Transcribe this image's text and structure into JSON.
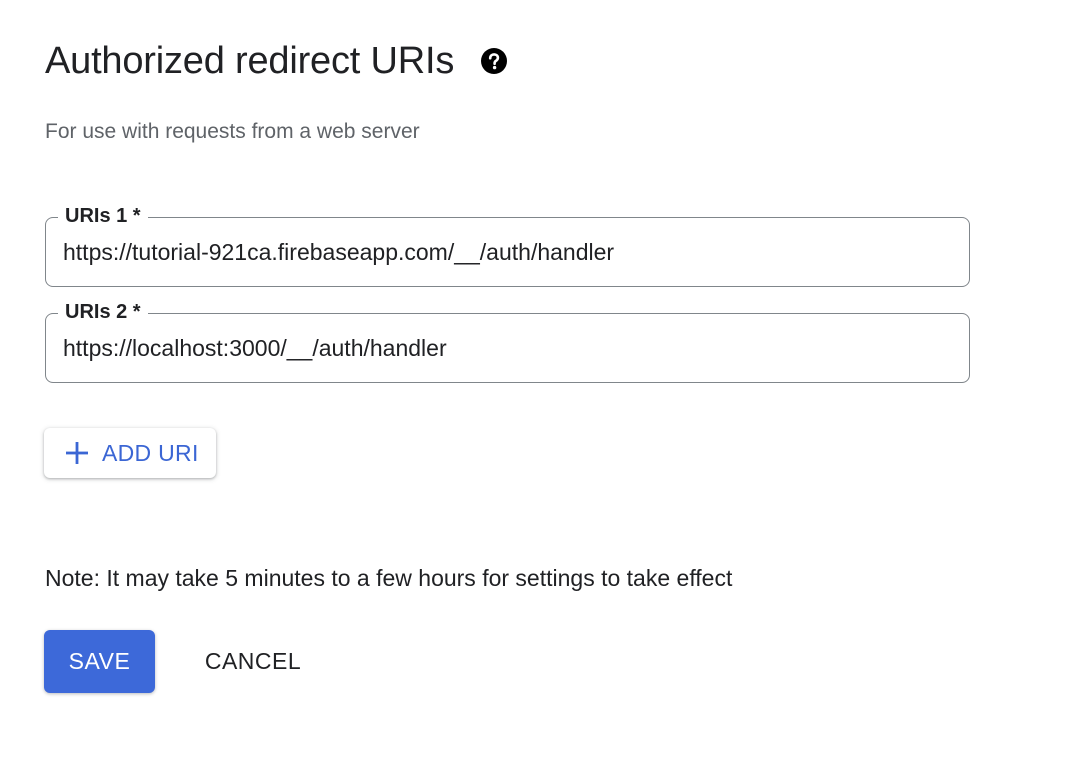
{
  "header": {
    "title": "Authorized redirect URIs",
    "help_icon": "help-circle-icon"
  },
  "subtitle": "For use with requests from a web server",
  "uris": [
    {
      "label": "URIs 1 *",
      "value": "https://tutorial-921ca.firebaseapp.com/__/auth/handler"
    },
    {
      "label": "URIs 2 *",
      "value": "https://localhost:3000/__/auth/handler"
    }
  ],
  "add_uri": {
    "label": "ADD URI",
    "icon": "plus-icon"
  },
  "note": "Note: It may take 5 minutes to a few hours for settings to take effect",
  "actions": {
    "save_label": "SAVE",
    "cancel_label": "CANCEL"
  },
  "colors": {
    "primary": "#3d69d9",
    "link": "#3b66d4",
    "text": "#202124",
    "secondary_text": "#5f6368",
    "border": "#80868b"
  }
}
